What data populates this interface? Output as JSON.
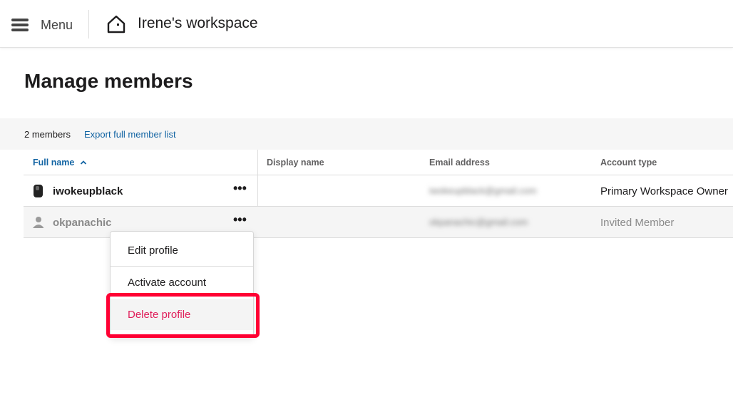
{
  "header": {
    "menu_label": "Menu",
    "workspace_title": "Irene's workspace"
  },
  "page": {
    "title": "Manage members"
  },
  "summary": {
    "member_count": "2 members",
    "export_link": "Export full member list"
  },
  "table": {
    "columns": [
      "Full name",
      "Display name",
      "Email address",
      "Account type"
    ],
    "sort_indicator": "^",
    "rows": [
      {
        "full_name": "iwokeupblack",
        "display_name": "",
        "email": "iwokeupblack@gmail.com",
        "account_type": "Primary Workspace Owner",
        "menu": "•••"
      },
      {
        "full_name": "okpanachic",
        "display_name": "",
        "email": "okpanachic@gmail.com",
        "account_type": "Invited Member",
        "menu": "•••"
      }
    ]
  },
  "context_menu": {
    "items": [
      "Edit profile",
      "Activate account",
      "Delete profile"
    ]
  },
  "colors": {
    "link": "#1264a3",
    "danger": "#e01e5a",
    "highlight": "#ff0033"
  },
  "icons": [
    "hamburger-icon",
    "home-icon",
    "sort-ascending-icon",
    "more-options-icon",
    "user-avatar-icon"
  ]
}
